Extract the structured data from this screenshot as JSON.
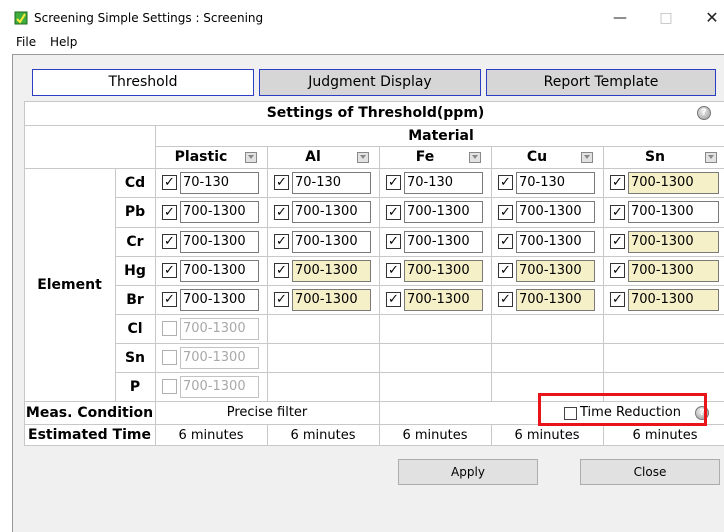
{
  "window": {
    "title": "Screening Simple Settings : Screening"
  },
  "menu": [
    "File",
    "Help"
  ],
  "tabs": [
    "Threshold",
    "Judgment Display",
    "Report Template"
  ],
  "header": {
    "title": "Settings of Threshold(ppm)",
    "material_label": "Material",
    "element_label": "Element"
  },
  "materials": [
    "Plastic",
    "Al",
    "Fe",
    "Cu",
    "Sn"
  ],
  "rows": [
    {
      "element": "Cd",
      "cells": [
        {
          "checked": true,
          "value": "70-130",
          "highlight": false,
          "enabled": true
        },
        {
          "checked": true,
          "value": "70-130",
          "highlight": false,
          "enabled": true
        },
        {
          "checked": true,
          "value": "70-130",
          "highlight": false,
          "enabled": true
        },
        {
          "checked": true,
          "value": "70-130",
          "highlight": false,
          "enabled": true
        },
        {
          "checked": true,
          "value": "700-1300",
          "highlight": true,
          "enabled": true
        }
      ]
    },
    {
      "element": "Pb",
      "cells": [
        {
          "checked": true,
          "value": "700-1300",
          "highlight": false,
          "enabled": true
        },
        {
          "checked": true,
          "value": "700-1300",
          "highlight": false,
          "enabled": true
        },
        {
          "checked": true,
          "value": "700-1300",
          "highlight": false,
          "enabled": true
        },
        {
          "checked": true,
          "value": "700-1300",
          "highlight": false,
          "enabled": true
        },
        {
          "checked": true,
          "value": "700-1300",
          "highlight": false,
          "enabled": true
        }
      ]
    },
    {
      "element": "Cr",
      "cells": [
        {
          "checked": true,
          "value": "700-1300",
          "highlight": false,
          "enabled": true
        },
        {
          "checked": true,
          "value": "700-1300",
          "highlight": false,
          "enabled": true
        },
        {
          "checked": true,
          "value": "700-1300",
          "highlight": false,
          "enabled": true
        },
        {
          "checked": true,
          "value": "700-1300",
          "highlight": false,
          "enabled": true
        },
        {
          "checked": true,
          "value": "700-1300",
          "highlight": true,
          "enabled": true
        }
      ]
    },
    {
      "element": "Hg",
      "cells": [
        {
          "checked": true,
          "value": "700-1300",
          "highlight": false,
          "enabled": true
        },
        {
          "checked": true,
          "value": "700-1300",
          "highlight": true,
          "enabled": true
        },
        {
          "checked": true,
          "value": "700-1300",
          "highlight": true,
          "enabled": true
        },
        {
          "checked": true,
          "value": "700-1300",
          "highlight": true,
          "enabled": true
        },
        {
          "checked": true,
          "value": "700-1300",
          "highlight": true,
          "enabled": true
        }
      ]
    },
    {
      "element": "Br",
      "cells": [
        {
          "checked": true,
          "value": "700-1300",
          "highlight": false,
          "enabled": true
        },
        {
          "checked": true,
          "value": "700-1300",
          "highlight": true,
          "enabled": true
        },
        {
          "checked": true,
          "value": "700-1300",
          "highlight": true,
          "enabled": true
        },
        {
          "checked": true,
          "value": "700-1300",
          "highlight": true,
          "enabled": true
        },
        {
          "checked": true,
          "value": "700-1300",
          "highlight": true,
          "enabled": true
        }
      ]
    },
    {
      "element": "Cl",
      "cells": [
        {
          "checked": false,
          "value": "700-1300",
          "highlight": false,
          "enabled": false
        }
      ]
    },
    {
      "element": "Sn",
      "cells": [
        {
          "checked": false,
          "value": "700-1300",
          "highlight": false,
          "enabled": false
        }
      ]
    },
    {
      "element": "P",
      "cells": [
        {
          "checked": false,
          "value": "700-1300",
          "highlight": false,
          "enabled": false
        }
      ]
    }
  ],
  "meas": {
    "label": "Meas. Condition",
    "value": "Precise filter",
    "time_reduction_label": "Time Reduction",
    "time_reduction_checked": false
  },
  "estimated": {
    "label": "Estimated Time",
    "values": [
      "6 minutes",
      "6 minutes",
      "6 minutes",
      "6 minutes",
      "6 minutes"
    ]
  },
  "buttons": {
    "apply": "Apply",
    "close": "Close"
  },
  "colors": {
    "tab_border": "#2b3ec2",
    "highlight_input": "#f5f0c8",
    "callout_red": "#e8141a"
  }
}
